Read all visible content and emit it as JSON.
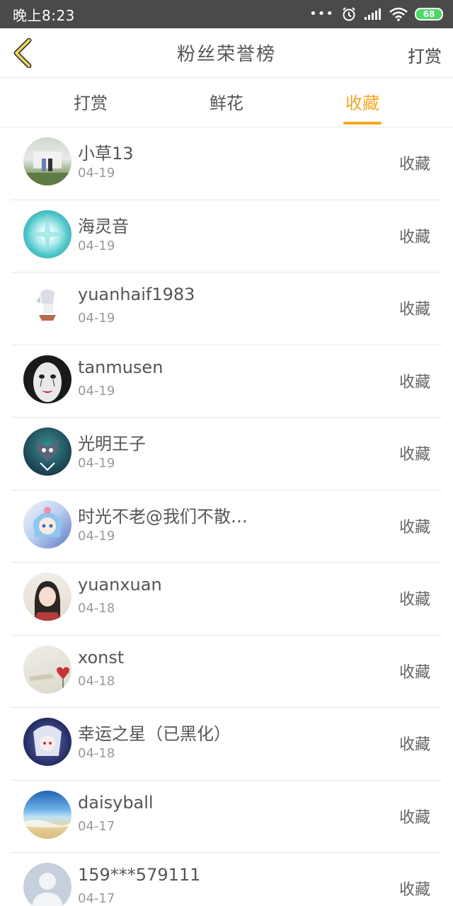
{
  "status_bar": {
    "time": "晚上8:23",
    "battery": "68"
  },
  "header": {
    "title": "粉丝荣誉榜",
    "right_action": "打赏",
    "back_icon": "chevron-left-icon",
    "accent": "#f5a623"
  },
  "tabs": [
    {
      "label": "打赏",
      "active": false
    },
    {
      "label": "鲜花",
      "active": false
    },
    {
      "label": "收藏",
      "active": true
    }
  ],
  "rows": [
    {
      "name": "小草13",
      "date": "04-19",
      "action": "收藏"
    },
    {
      "name": "海灵音",
      "date": "04-19",
      "action": "收藏"
    },
    {
      "name": "yuanhaif1983",
      "date": "04-19",
      "action": "收藏"
    },
    {
      "name": "tanmusen",
      "date": "04-19",
      "action": "收藏"
    },
    {
      "name": "光明王子",
      "date": "04-19",
      "action": "收藏"
    },
    {
      "name": "时光不老@我们不散…",
      "date": "04-19",
      "action": "收藏"
    },
    {
      "name": "yuanxuan",
      "date": "04-18",
      "action": "收藏"
    },
    {
      "name": "xonst",
      "date": "04-18",
      "action": "收藏"
    },
    {
      "name": "幸运之星（已黑化）",
      "date": "04-18",
      "action": "收藏"
    },
    {
      "name": "daisyball",
      "date": "04-17",
      "action": "收藏"
    },
    {
      "name": "159***579111",
      "date": "04-17",
      "action": "收藏"
    }
  ]
}
